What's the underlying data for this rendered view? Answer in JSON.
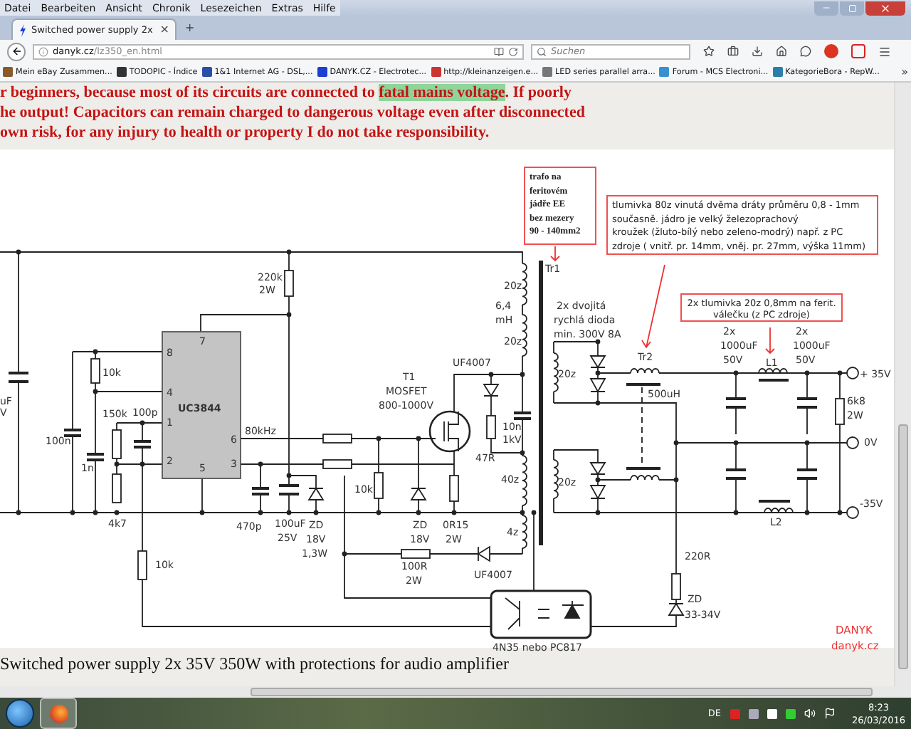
{
  "menu": [
    "Datei",
    "Bearbeiten",
    "Ansicht",
    "Chronik",
    "Lesezeichen",
    "Extras",
    "Hilfe"
  ],
  "tab": {
    "title": "Switched power supply 2x",
    "selected": true,
    "close": "×"
  },
  "new_tab": "+",
  "address": {
    "host": "danyk.cz",
    "path": "/lz350_en.html"
  },
  "search": {
    "placeholder": "Suchen"
  },
  "bookmarks": [
    "Mein eBay Zusammen...",
    "TODOPIC - Índice",
    "1&1 Internet AG - DSL,...",
    "DANYK.CZ - Electrotec...",
    "http://kleinanzeigen.e...",
    "LED series parallel arra...",
    "Forum - MCS Electroni...",
    "KategorieBora - RepW..."
  ],
  "bookmarks_more": "»",
  "warning": {
    "line_1": {
      "before": "r beginners, because most of its circuits are connected to ",
      "highlight": "fatal mains voltage",
      "after": ". If poorly"
    },
    "line_2": "he output! Capacitors can remain charged to dangerous voltage even after disconnected",
    "line_3": " own risk, for any injury to health or property I do not take responsibility."
  },
  "schematic": {
    "labels": [
      "220k",
      "2W",
      "7",
      "8",
      "10k",
      "4",
      "UC3844",
      "150k",
      "100p",
      "1",
      "80kHz",
      "100n",
      "6",
      "1n",
      "2",
      "5",
      "3",
      "4k7",
      "470p",
      "100uF",
      "25V",
      "ZD",
      "18V",
      "1,3W",
      "10k",
      "ZD",
      "18V",
      "0R15",
      "2W",
      "100R",
      "2W",
      "10k",
      "T1",
      "MOSFET",
      "800-1000V",
      "UF4007",
      "20z",
      "6,4",
      "mH",
      "20z",
      "10n",
      "1kV",
      "47R",
      "40z",
      "4z",
      "UF4007",
      "Tr1",
      "2x dvojitá",
      "rychlá dioda",
      "min. 300V 8A",
      "20z",
      "Tr2",
      "500uH",
      "2x",
      "1000uF",
      "50V",
      "L1",
      "2x",
      "1000uF",
      "50V",
      "+ 35V",
      "6k8",
      "2W",
      "0V",
      "20z",
      "-35V",
      "L2",
      "220R",
      "ZD",
      "33-34V",
      "4N35 nebo PC817",
      "uF",
      "V"
    ],
    "notes": [
      {
        "lines": [
          "trafo na",
          "feritovém",
          "jádře EE",
          "bez mezery",
          "90 - 140mm2"
        ]
      },
      {
        "lines": [
          "tlumivka 80z vinutá dvěma dráty průměru 0,8 - 1mm",
          "současně. jádro je velký železoprachový",
          "kroužek  (žluto-bílý nebo zeleno-modrý) např. z PC",
          "zdroje ( vnitř. pr. 14mm, vněj. pr. 27mm, výška 11mm)"
        ]
      },
      {
        "lines": [
          "2x tlumivka 20z 0,8mm na ferit.",
          "válečku (z PC zdroje)"
        ]
      }
    ],
    "credit": [
      "DANYK",
      "danyk.cz"
    ]
  },
  "caption": "Switched power supply 2x 35V 350W with protections for audio amplifier",
  "taskbar": {
    "language": "DE",
    "time": "8:23",
    "date": "26/03/2016"
  }
}
